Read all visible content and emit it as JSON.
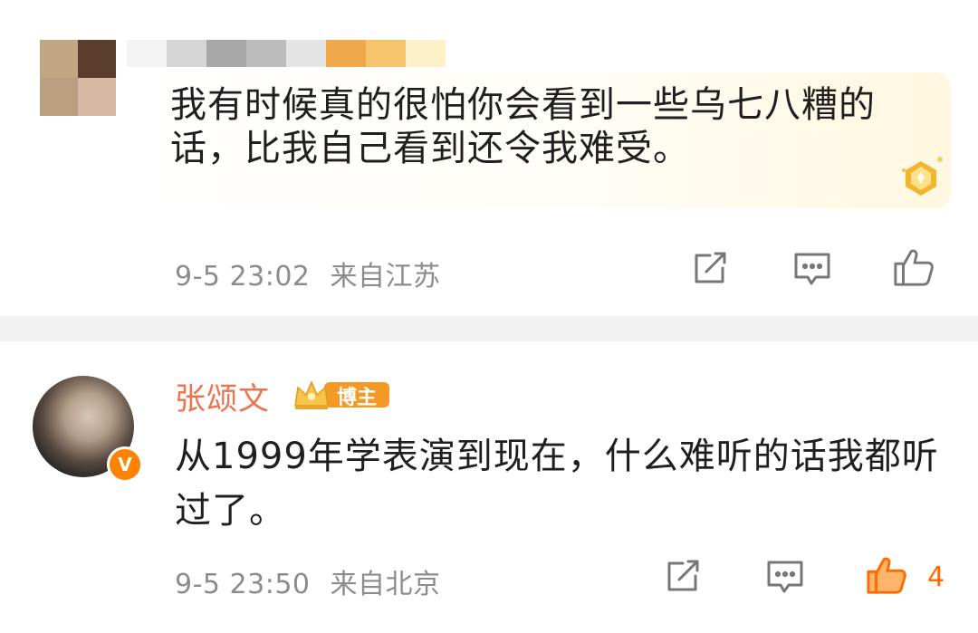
{
  "comment1": {
    "text": "我有时候真的很怕你会看到一些乌七八糟的话，比我自己看到还令我难受。",
    "meta_time": "9-5 23:02",
    "meta_location": "来自江苏",
    "icons": [
      "share-icon",
      "comment-icon",
      "like-icon"
    ]
  },
  "comment2": {
    "username": "张颂文",
    "role_badge": "博主",
    "verified_mark": "V",
    "text": "从1999年学表演到现在，什么难听的话我都听过了。",
    "meta_time": "9-5 23:50",
    "meta_location": "来自北京",
    "like_count": "4",
    "icons": [
      "share-icon",
      "comment-icon",
      "like-icon"
    ]
  },
  "colors": {
    "username": "#eb7350",
    "meta_text": "#8c8c8c",
    "liked": "#ff6a00",
    "verified_badge": "#ff8200",
    "divider": "#f2f2f2"
  }
}
